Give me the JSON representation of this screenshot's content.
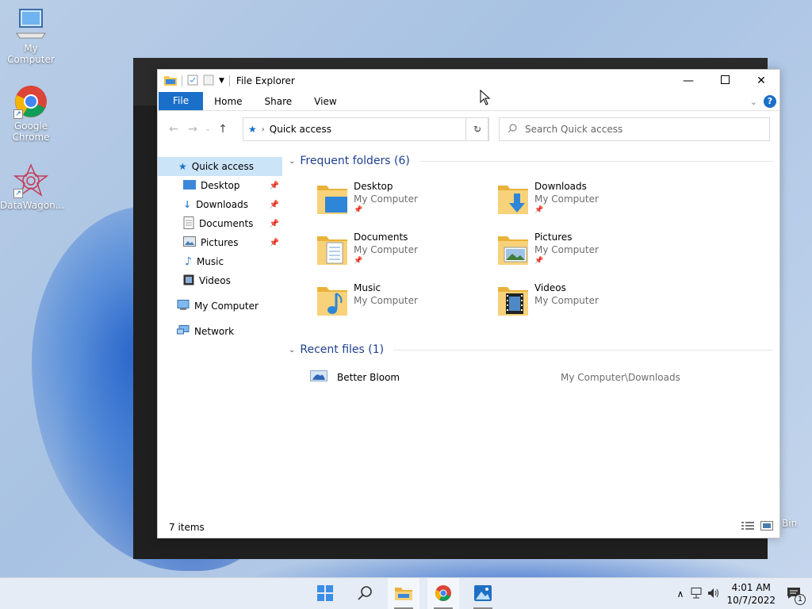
{
  "desktop": {
    "icons": [
      {
        "label": "My Computer"
      },
      {
        "label": "Google Chrome"
      },
      {
        "label": "DataWagon..."
      }
    ],
    "recycle_bin_label": "Bin"
  },
  "window": {
    "title": "File Explorer",
    "ribbon_tabs": [
      "File",
      "Home",
      "Share",
      "View"
    ],
    "address": {
      "location": "Quick access"
    },
    "search": {
      "placeholder": "Search Quick access"
    },
    "sidebar": [
      {
        "label": "Quick access",
        "pinned": false
      },
      {
        "label": "Desktop",
        "pinned": true
      },
      {
        "label": "Downloads",
        "pinned": true
      },
      {
        "label": "Documents",
        "pinned": true
      },
      {
        "label": "Pictures",
        "pinned": true
      },
      {
        "label": "Music",
        "pinned": false
      },
      {
        "label": "Videos",
        "pinned": false
      },
      {
        "label": "My Computer",
        "pinned": false
      },
      {
        "label": "Network",
        "pinned": false
      }
    ],
    "frequent_header": "Frequent folders (6)",
    "frequent_folders": [
      {
        "name": "Desktop",
        "location": "My Computer",
        "pinned": true
      },
      {
        "name": "Downloads",
        "location": "My Computer",
        "pinned": true
      },
      {
        "name": "Documents",
        "location": "My Computer",
        "pinned": true
      },
      {
        "name": "Pictures",
        "location": "My Computer",
        "pinned": true
      },
      {
        "name": "Music",
        "location": "My Computer",
        "pinned": false
      },
      {
        "name": "Videos",
        "location": "My Computer",
        "pinned": false
      }
    ],
    "recent_header": "Recent files (1)",
    "recent_files": [
      {
        "name": "Better Bloom",
        "path": "My Computer\\Downloads"
      }
    ],
    "status": "7 items"
  },
  "taskbar": {
    "time": "4:01 AM",
    "date": "10/7/2022",
    "notification_count": "1"
  },
  "colors": {
    "accent": "#1a6fc9",
    "selection": "#cce4f7",
    "folder": "#f4c64e"
  }
}
